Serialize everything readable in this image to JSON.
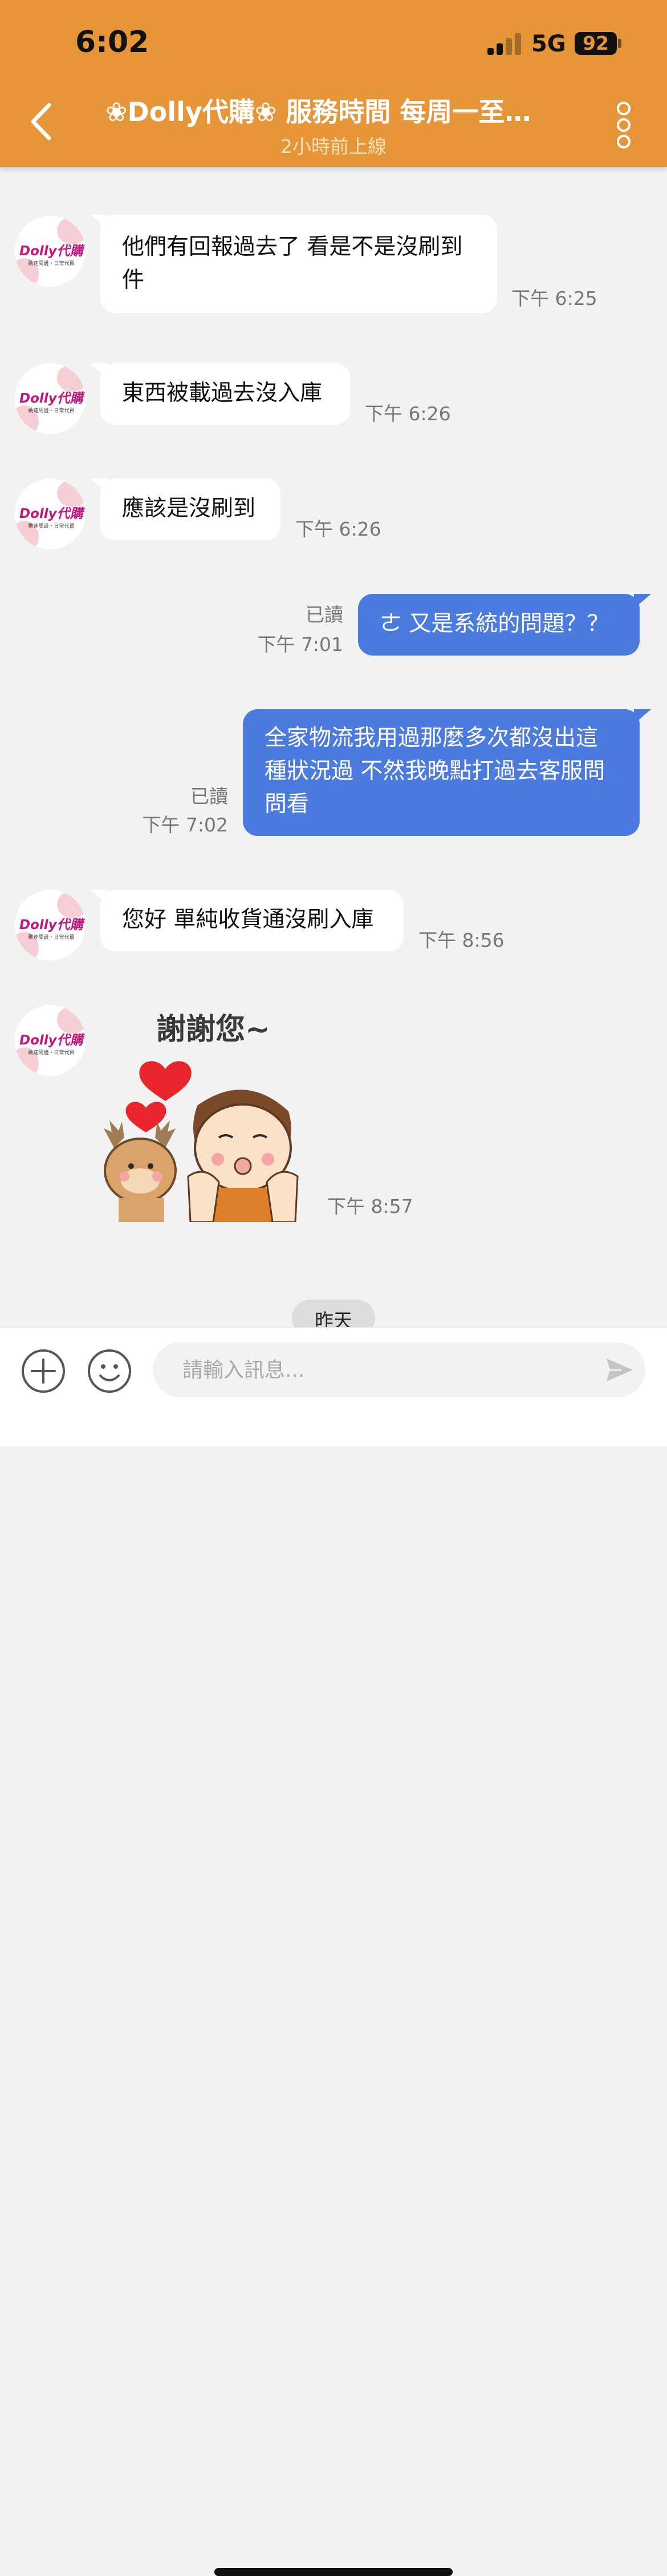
{
  "status_bar": {
    "time": "6:02",
    "network": "5G",
    "battery": "92"
  },
  "header": {
    "title": "❀Dolly代購❀ 服務時間 每周一至…",
    "subtitle": "2小時前上線"
  },
  "avatar": {
    "brand": "Dolly代購",
    "tagline": "動速周邊・日常代買"
  },
  "messages": [
    {
      "direction": "in",
      "text": "他們有回報過去了 看是不是沒刷到件",
      "time": "下午 6:25"
    },
    {
      "direction": "in",
      "text": "東西被載過去沒入庫",
      "time": "下午 6:26"
    },
    {
      "direction": "in",
      "text": "應該是沒刷到",
      "time": "下午 6:26"
    },
    {
      "direction": "out",
      "text": "ㄜ 又是系統的問題？？",
      "read": "已讀",
      "time": "下午 7:01"
    },
    {
      "direction": "out",
      "text": "全家物流我用過那麼多次都沒出這種狀況過 不然我晚點打過去客服問問看",
      "read": "已讀",
      "time": "下午 7:02"
    },
    {
      "direction": "in",
      "text": "您好 單純收貨通沒刷入庫",
      "time": "下午 8:56"
    },
    {
      "direction": "in",
      "type": "sticker",
      "sticker_text": "謝謝您~",
      "time": "下午 8:57"
    }
  ],
  "date_divider": "昨天",
  "composer": {
    "placeholder": "請輸入訊息..."
  },
  "colors": {
    "header": "#e69638",
    "outgoing_bubble": "#4b7bdf",
    "incoming_bubble": "#ffffff",
    "background": "#f2f2f2"
  }
}
